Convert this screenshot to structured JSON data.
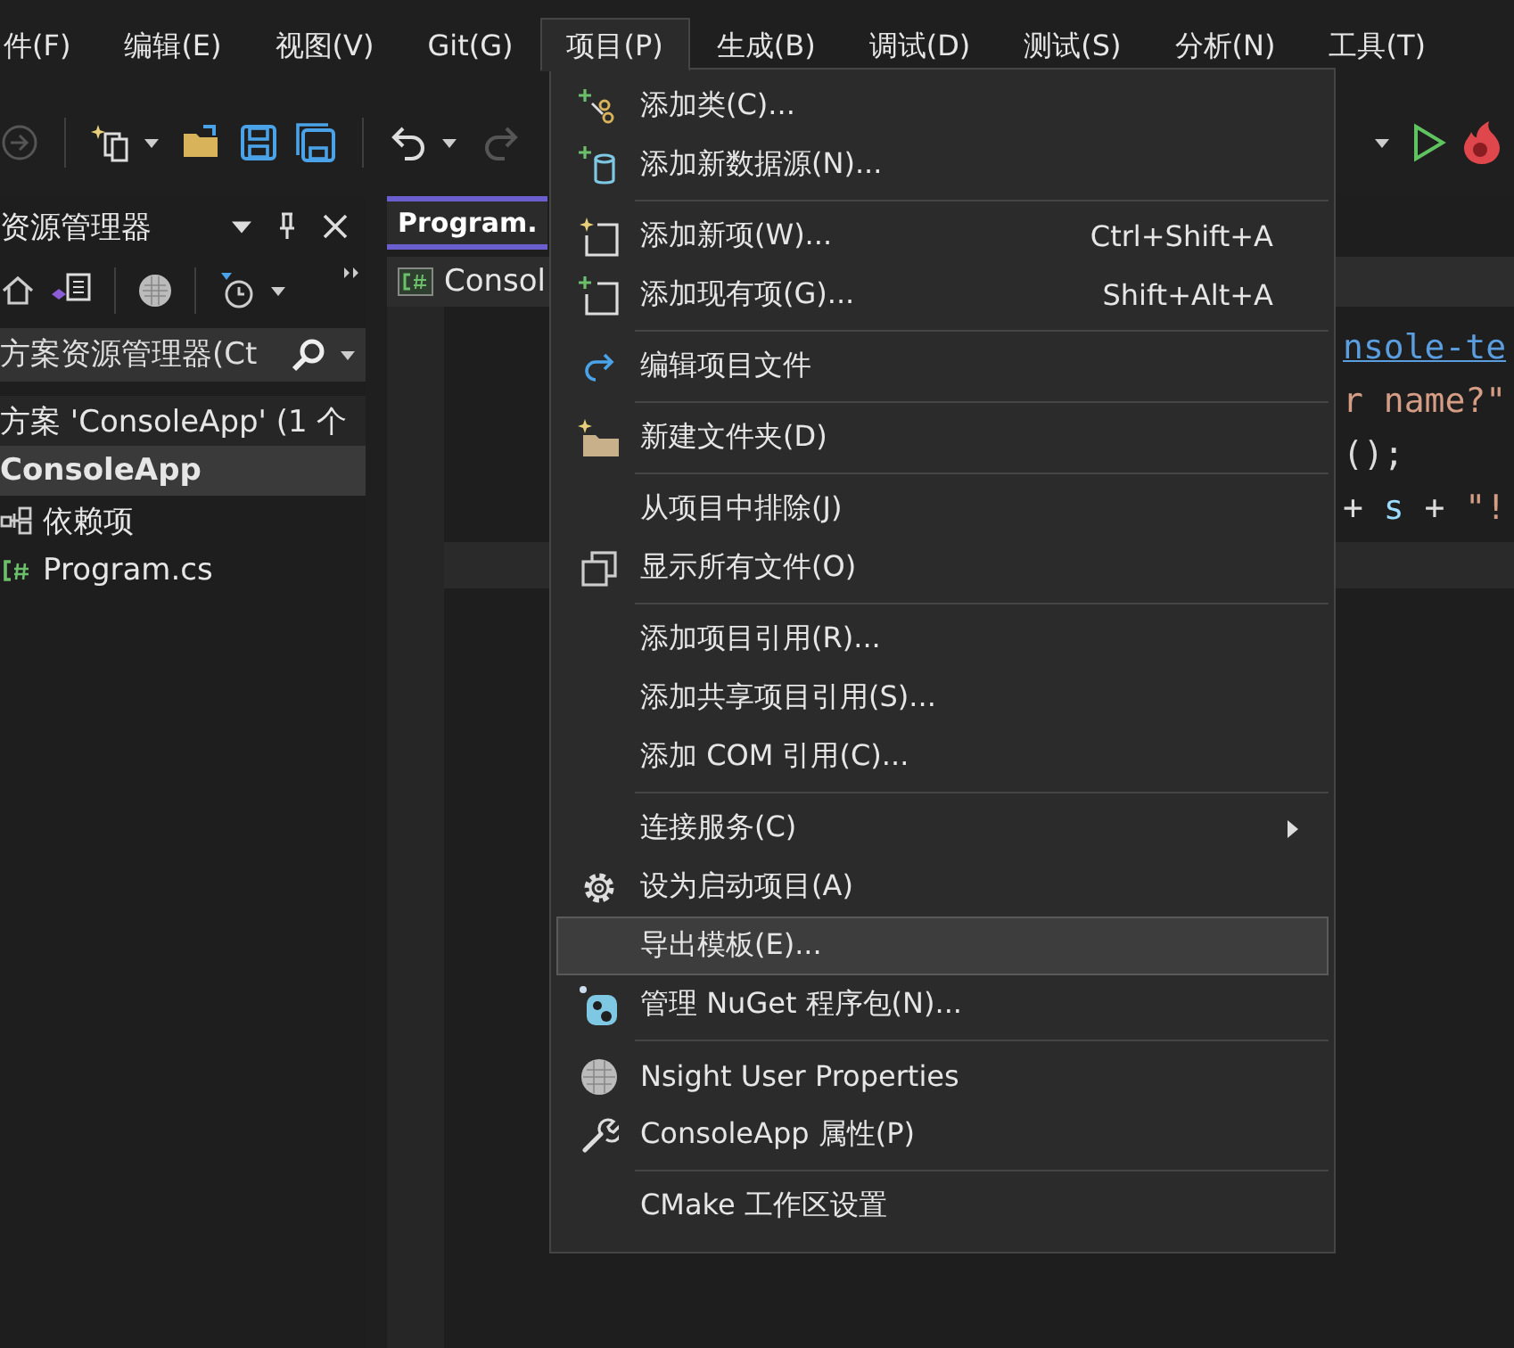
{
  "menubar": [
    {
      "label": "件(F)",
      "selected": false
    },
    {
      "label": "编辑(E)",
      "selected": false
    },
    {
      "label": "视图(V)",
      "selected": false
    },
    {
      "label": "Git(G)",
      "selected": false
    },
    {
      "label": "项目(P)",
      "selected": true
    },
    {
      "label": "生成(B)",
      "selected": false
    },
    {
      "label": "调试(D)",
      "selected": false
    },
    {
      "label": "测试(S)",
      "selected": false
    },
    {
      "label": "分析(N)",
      "selected": false
    },
    {
      "label": "工具(T)",
      "selected": false
    }
  ],
  "solution_explorer": {
    "title": "资源管理器",
    "search": {
      "placeholder": "方案资源管理器(Ct"
    },
    "tree": [
      {
        "label": "方案 'ConsoleApp' (1 个",
        "selected": false,
        "children": [
          {
            "label": "ConsoleApp",
            "selected": true,
            "children": [
              {
                "label": "依赖项",
                "kind": "dependencies",
                "selected": false
              },
              {
                "label": "Program.cs",
                "kind": "csharp",
                "selected": false
              }
            ]
          }
        ]
      }
    ]
  },
  "editor": {
    "tab": {
      "label": "Program.",
      "selected": true
    },
    "navbar": {
      "label": "Consol"
    },
    "code_lines": [
      [
        {
          "text": "nsole-te",
          "kind": "link"
        }
      ],
      [
        {
          "text": "r name?\"",
          "kind": "string"
        }
      ],
      [
        {
          "text": "();",
          "kind": "plain"
        }
      ],
      [
        {
          "text": "+ ",
          "kind": "plain"
        },
        {
          "text": "s",
          "kind": "variable"
        },
        {
          "text": " + ",
          "kind": "plain"
        },
        {
          "text": "\"!",
          "kind": "string"
        }
      ]
    ]
  },
  "project_menu": {
    "groups": [
      [
        {
          "label": "添加类(C)...",
          "kind": "add-class",
          "selected": false,
          "submenu": false
        },
        {
          "label": "添加新数据源(N)...",
          "kind": "data-source",
          "selected": false,
          "submenu": false
        }
      ],
      [
        {
          "label": "添加新项(W)...",
          "shortcut": "Ctrl+Shift+A",
          "kind": "new-item",
          "selected": false,
          "submenu": false
        },
        {
          "label": "添加现有项(G)...",
          "shortcut": "Shift+Alt+A",
          "kind": "existing-item",
          "selected": false,
          "submenu": false
        }
      ],
      [
        {
          "label": "编辑项目文件",
          "kind": "edit",
          "selected": false,
          "submenu": false
        }
      ],
      [
        {
          "label": "新建文件夹(D)",
          "kind": "new-folder",
          "selected": false,
          "submenu": false
        }
      ],
      [
        {
          "label": "从项目中排除(J)",
          "kind": "none",
          "selected": false,
          "submenu": false
        },
        {
          "label": "显示所有文件(O)",
          "kind": "show-all",
          "selected": false,
          "submenu": false
        }
      ],
      [
        {
          "label": "添加项目引用(R)...",
          "kind": "none",
          "selected": false,
          "submenu": false
        },
        {
          "label": "添加共享项目引用(S)...",
          "kind": "none",
          "selected": false,
          "submenu": false
        },
        {
          "label": "添加 COM 引用(C)...",
          "kind": "none",
          "selected": false,
          "submenu": false
        }
      ],
      [
        {
          "label": "连接服务(C)",
          "kind": "none",
          "selected": false,
          "submenu": true
        },
        {
          "label": "设为启动项目(A)",
          "kind": "gear",
          "selected": false,
          "submenu": false
        },
        {
          "label": "导出模板(E)...",
          "kind": "none",
          "selected": true,
          "submenu": false
        },
        {
          "label": "管理 NuGet 程序包(N)...",
          "kind": "nuget",
          "selected": false,
          "submenu": false
        }
      ],
      [
        {
          "label": "Nsight User Properties",
          "kind": "globe",
          "selected": false,
          "submenu": false
        },
        {
          "label": "ConsoleApp 属性(P)",
          "kind": "wrench",
          "selected": false,
          "submenu": false
        }
      ],
      [
        {
          "label": "CMake 工作区设置",
          "kind": "none",
          "selected": false,
          "submenu": false
        }
      ]
    ]
  }
}
